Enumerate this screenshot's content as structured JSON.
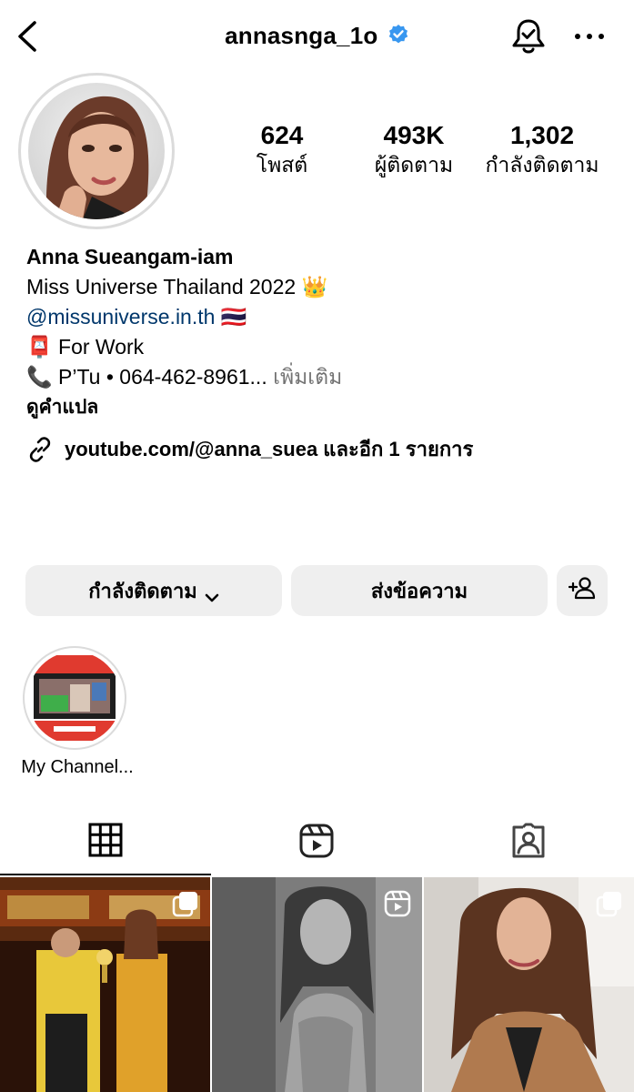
{
  "header": {
    "username": "annasnga_1o",
    "verified": true,
    "icons": [
      "back-arrow-icon",
      "verified-badge-icon",
      "notification-bell-icon",
      "more-options-icon"
    ]
  },
  "stats": {
    "posts": {
      "value": "624",
      "label": "โพสต์"
    },
    "followers": {
      "value": "493K",
      "label": "ผู้ติดตาม"
    },
    "following": {
      "value": "1,302",
      "label": "กำลังติดตาม"
    }
  },
  "bio": {
    "name": "Anna Sueangam-iam",
    "line1": "Miss Universe Thailand 2022 👑",
    "mention": "@missuniverse.in.th",
    "mention_flag": "🇹🇭",
    "line3_emoji": "📮",
    "line3_text": "For Work",
    "line4_emoji": "📞",
    "line4_text": "P’Tu • 064-462-8961...",
    "more": "เพิ่มเติม",
    "translate": "ดูคำแปล",
    "link": "youtube.com/@anna_suea และอีก 1 รายการ"
  },
  "actions": {
    "following": "กำลังติดตาม",
    "message": "ส่งข้อความ"
  },
  "highlights": [
    {
      "label": "My Channel..."
    }
  ],
  "tabs": [
    "posts-grid-icon",
    "reels-icon",
    "tagged-icon"
  ],
  "colors": {
    "accent_blue": "#3897f0",
    "mention_blue": "#00376b",
    "button_bg": "#efefef",
    "muted": "#737373"
  }
}
